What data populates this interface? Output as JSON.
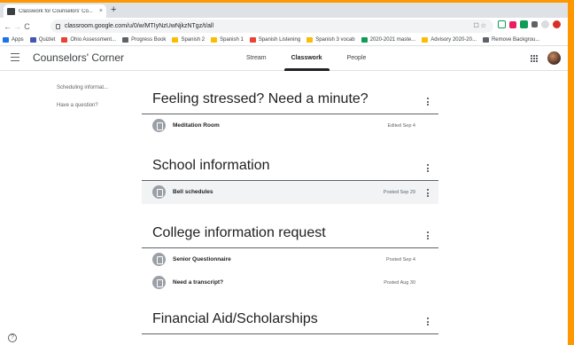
{
  "browser": {
    "tab_title": "Classwork for Counselors' Co...",
    "tab_close": "×",
    "new_tab": "+",
    "url": "classroom.google.com/u/0/w/MTIyNzUwNjkzNTgz/t/all",
    "nav_back": "←",
    "nav_forward": "→",
    "nav_reload": "C",
    "omnibox_icons": "☐ ☆"
  },
  "bookmarks": [
    {
      "label": "Apps",
      "color": "#1a73e8"
    },
    {
      "label": "Quizlet",
      "color": "#4257b2"
    },
    {
      "label": "Ohio Assessment...",
      "color": "#ea4335"
    },
    {
      "label": "Progress Book",
      "color": "#5f6368"
    },
    {
      "label": "Spanish 2",
      "color": "#fbbc04"
    },
    {
      "label": "Spanish 1",
      "color": "#fbbc04"
    },
    {
      "label": "Spanish Listening",
      "color": "#ea4335"
    },
    {
      "label": "Spanish 3 vocab",
      "color": "#fbbc04"
    },
    {
      "label": "2020-2021 maste...",
      "color": "#0f9d58"
    },
    {
      "label": "Advisory 2020-20...",
      "color": "#fbbc04"
    },
    {
      "label": "Remove Backgrou...",
      "color": "#5f6368"
    }
  ],
  "header": {
    "class_name": "Counselors' Corner",
    "tabs": [
      "Stream",
      "Classwork",
      "People"
    ],
    "active_tab": "Classwork"
  },
  "sidebar": {
    "links": [
      "Scheduling informat...",
      "Have a question?"
    ]
  },
  "topics": [
    {
      "title": "Feeling stressed? Need a minute?",
      "items": [
        {
          "title": "Meditation Room",
          "date": "Edited Sep 4"
        }
      ]
    },
    {
      "title": "School information",
      "items": [
        {
          "title": "Bell schedules",
          "date": "Posted Sep 29"
        }
      ]
    },
    {
      "title": "College information request",
      "items": [
        {
          "title": "Senior Questionnaire",
          "date": "Posted Sep 4"
        },
        {
          "title": "Need a transcript?",
          "date": "Posted Aug 30"
        }
      ]
    },
    {
      "title": "Financial Aid/Scholarships",
      "items": []
    }
  ],
  "help": "?"
}
